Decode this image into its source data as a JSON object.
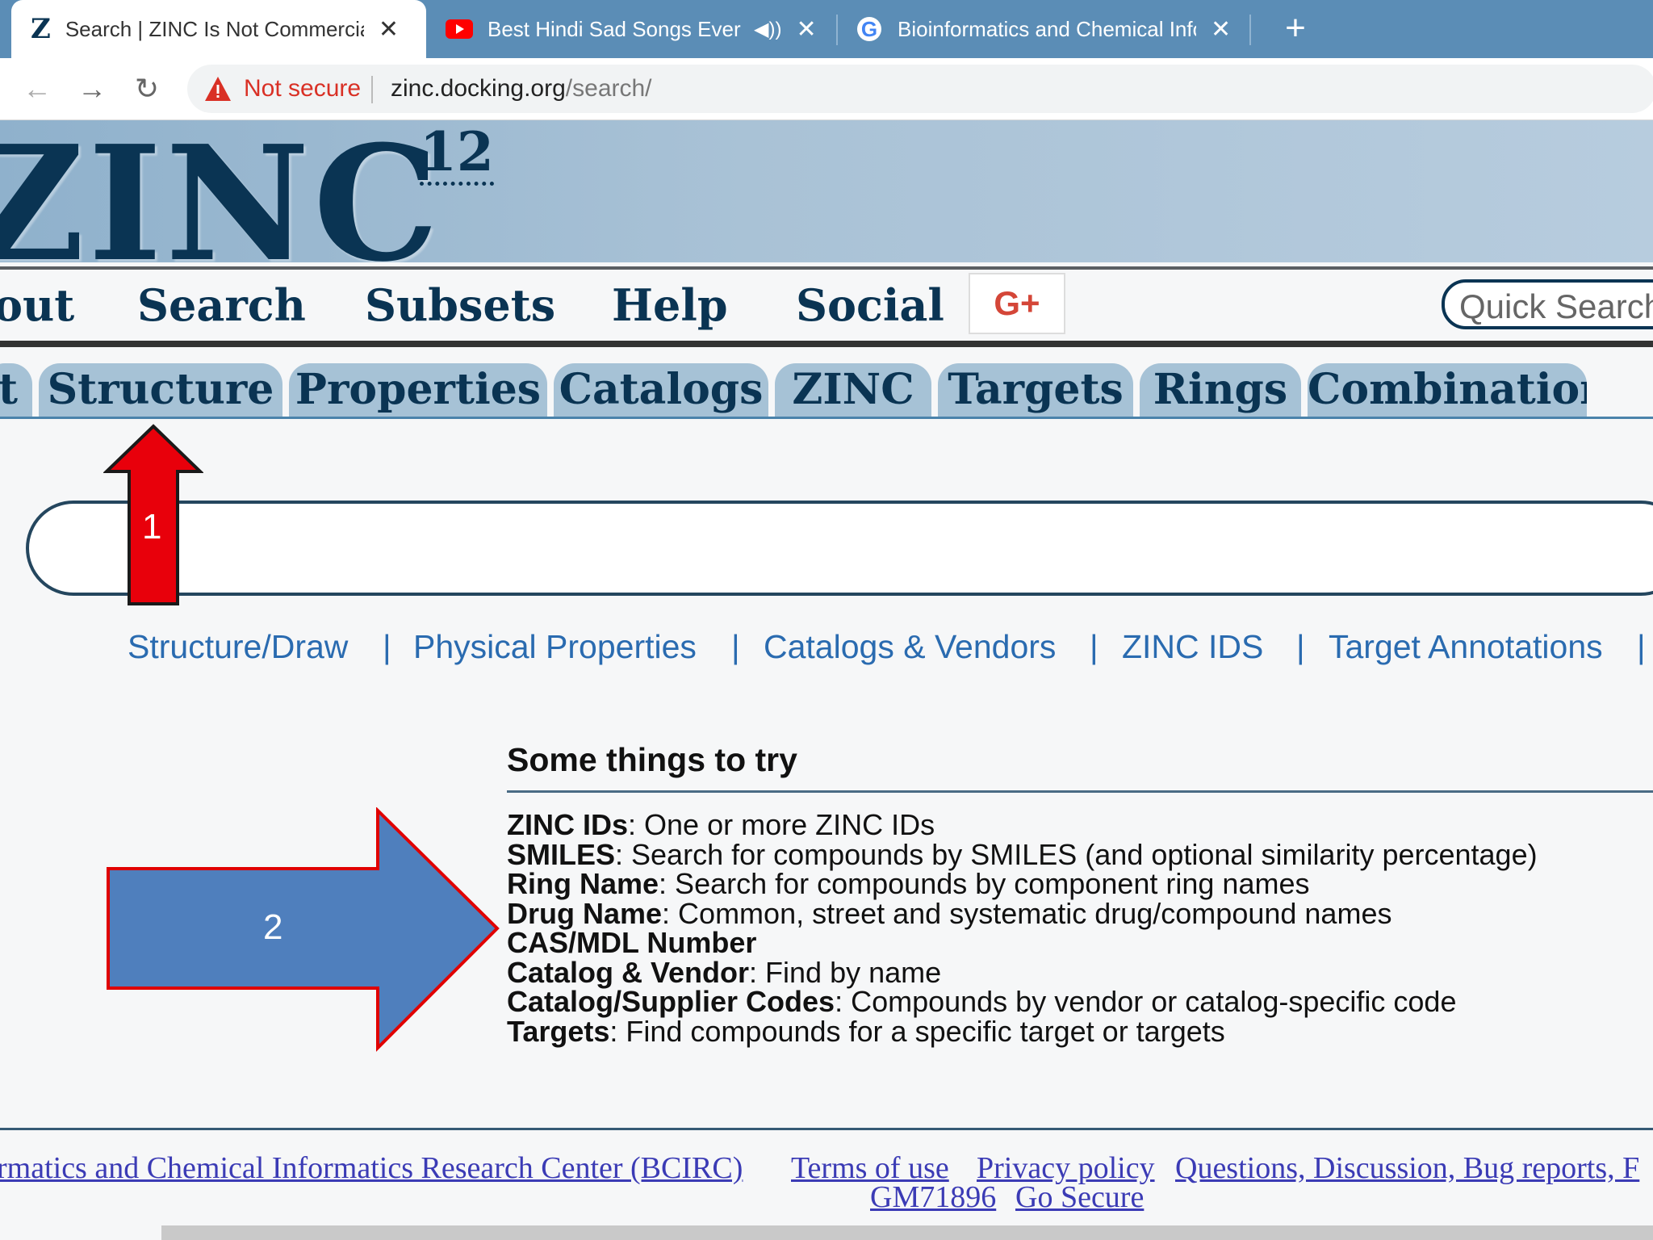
{
  "browser": {
    "tabs": [
      {
        "title": "Search | ZINC Is Not Commercial"
      },
      {
        "title": "Best Hindi Sad Songs Ever T"
      },
      {
        "title": "Bioinformatics and Chemical Info"
      }
    ],
    "new_tab_label": "+",
    "close_glyph": "✕",
    "security_label": "Not secure",
    "url_host": "zinc.docking.org",
    "url_path": "/search/"
  },
  "page": {
    "logo": "ZINC",
    "logo_version": "12",
    "nav": [
      "out",
      "Search",
      "Subsets",
      "Help",
      "Social"
    ],
    "gplus_label": "G+",
    "quick_search_placeholder": "Quick Search",
    "subtabs": [
      "t",
      "Structure",
      "Properties",
      "Catalogs",
      "ZINC",
      "Targets",
      "Rings",
      "Combination"
    ],
    "search_links": [
      "Structure/Draw",
      "Physical Properties",
      "Catalogs & Vendors",
      "ZINC IDS",
      "Target Annotations"
    ],
    "try": {
      "title": "Some things to try",
      "items": [
        {
          "term": "ZINC IDs",
          "desc": ": One or more ZINC IDs"
        },
        {
          "term": "SMILES",
          "desc": ": Search for compounds by SMILES (and optional similarity percentage)"
        },
        {
          "term": "Ring Name",
          "desc": ": Search for compounds by component ring names"
        },
        {
          "term": "Drug Name",
          "desc": ": Common, street and systematic drug/compound names"
        },
        {
          "term": "CAS/MDL Number",
          "desc": ""
        },
        {
          "term": "Catalog & Vendor",
          "desc": ": Find by name"
        },
        {
          "term": "Catalog/Supplier Codes",
          "desc": ": Compounds by vendor or catalog-specific code"
        },
        {
          "term": "Targets",
          "desc": ": Find compounds for a specific target or targets"
        }
      ]
    },
    "footer": {
      "org": "rmatics and Chemical Informatics Research Center (BCIRC)",
      "terms": "Terms of use",
      "privacy": "Privacy policy",
      "questions": "Questions, Discussion, Bug reports, F",
      "grant": "GM71896",
      "go_secure": "Go Secure"
    }
  },
  "annotations": {
    "arrow1_label": "1",
    "arrow2_label": "2",
    "arrow1_color": "#e8000b",
    "arrow2_color": "#4f7fbd",
    "arrow_border": "#e00000"
  }
}
